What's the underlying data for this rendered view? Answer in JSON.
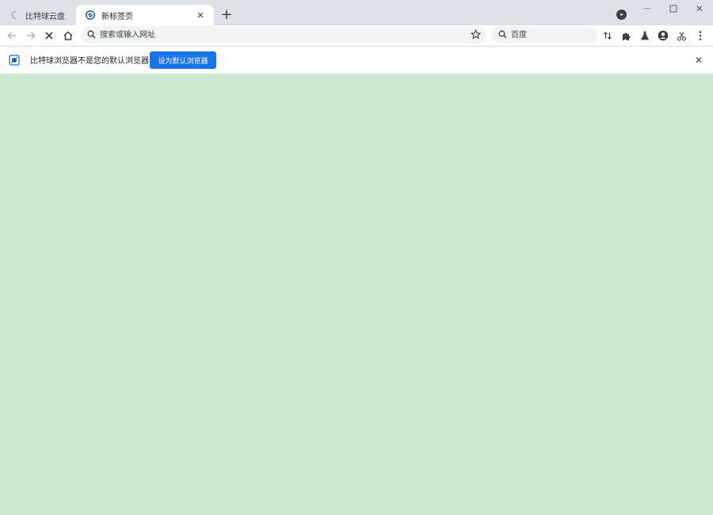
{
  "colors": {
    "tabstrip": "#dee1e6",
    "toolbar": "#ffffff",
    "content_background": "#cce8d0",
    "accent": "#1a73e8",
    "icon": "#5f6368"
  },
  "tabs": [
    {
      "title": "比特球云盘",
      "icon": "loading-spinner-icon",
      "active": false
    },
    {
      "title": "新标签页",
      "icon": "bitball-browser-icon",
      "active": true
    }
  ],
  "tab_close_glyph": "✕",
  "new_tab_glyph": "+",
  "window_controls": {
    "minimize_glyph": "—",
    "close_glyph": "✕"
  },
  "toolbar": {
    "back_icon": "back-arrow-icon",
    "forward_icon": "forward-arrow-icon",
    "stop_icon": "stop-loading-icon",
    "home_icon": "home-icon"
  },
  "omnibox": {
    "placeholder": "搜索或输入网址",
    "value": ""
  },
  "search_box": {
    "placeholder": "百度",
    "value": ""
  },
  "infobar": {
    "message": "比特球浏览器不是您的默认浏览器",
    "button_label": "设为默认浏览器",
    "close_glyph": "✕"
  }
}
